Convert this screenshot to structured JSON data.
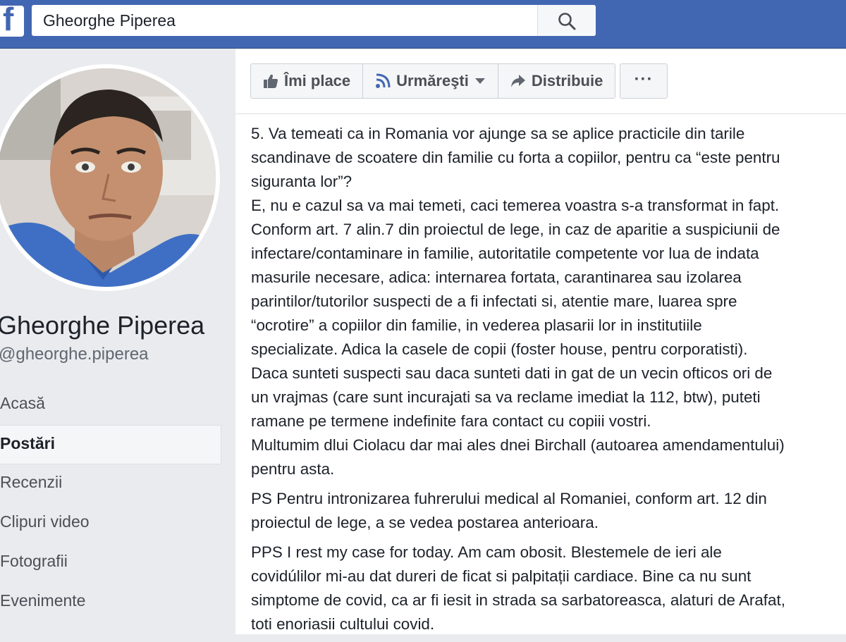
{
  "header": {
    "search_value": "Gheorghe Piperea"
  },
  "profile": {
    "name": "Gheorghe Piperea",
    "handle": "@gheorghe.piperea"
  },
  "nav": {
    "items": [
      {
        "label": "Acasă"
      },
      {
        "label": "Postări"
      },
      {
        "label": "Recenzii"
      },
      {
        "label": "Clipuri video"
      },
      {
        "label": "Fotografii"
      },
      {
        "label": "Evenimente"
      }
    ]
  },
  "actions": {
    "like_label": "Îmi place",
    "follow_label": "Urmăreşti",
    "share_label": "Distribuie",
    "more_label": "···"
  },
  "post": {
    "paragraphs": [
      [
        "5. Va temeati ca in Romania vor ajunge sa se aplice practicile din tarile",
        "scandinave de scoatere din familie cu forta a copiilor, pentru ca “este pentru",
        "siguranta lor”?",
        "E, nu e cazul sa va mai temeti, caci temerea voastra s-a transformat in fapt.",
        "Conform art. 7 alin.7 din proiectul de lege, in caz de aparitie a suspiciunii de",
        "infectare/contaminare in familie, autoritatile competente vor lua de indata",
        "masurile necesare, adica: internarea fortata, carantinarea sau izolarea",
        "parintilor/tutorilor suspecti de a fi infectati si, atentie mare, luarea spre",
        "“ocrotire” a copiilor din familie, in vederea plasarii lor in institutiile",
        "specializate. Adica la casele de copii (foster house, pentru corporatisti).",
        "Daca sunteti suspecti sau daca sunteti dati in gat de un vecin ofticos ori de",
        "un vrajmas (care sunt incurajati sa va reclame imediat la 112, btw), puteti",
        "ramane pe termene indefinite fara contact cu copiii vostri.",
        "Multumim dlui Ciolacu dar mai ales dnei Birchall (autoarea amendamentului)",
        "pentru asta."
      ],
      [
        "PS Pentru intronizarea fuhrerului medical al Romaniei, conform art. 12 din",
        "proiectul de lege, a se vedea postarea anterioara."
      ],
      [
        "PPS I rest my case for today. Am cam obosit. Blestemele de ieri ale",
        "covidúlilor mi-au dat dureri de ficat si palpitații cardiace. Bine ca nu sunt",
        "simptome de covid, ca ar fi iesit in strada sa sarbatoreasca, alaturi de Arafat,",
        "toti enoriasii cultului covid."
      ]
    ]
  },
  "colors": {
    "brand": "#4267b2",
    "page_bg": "#e9ebee"
  }
}
